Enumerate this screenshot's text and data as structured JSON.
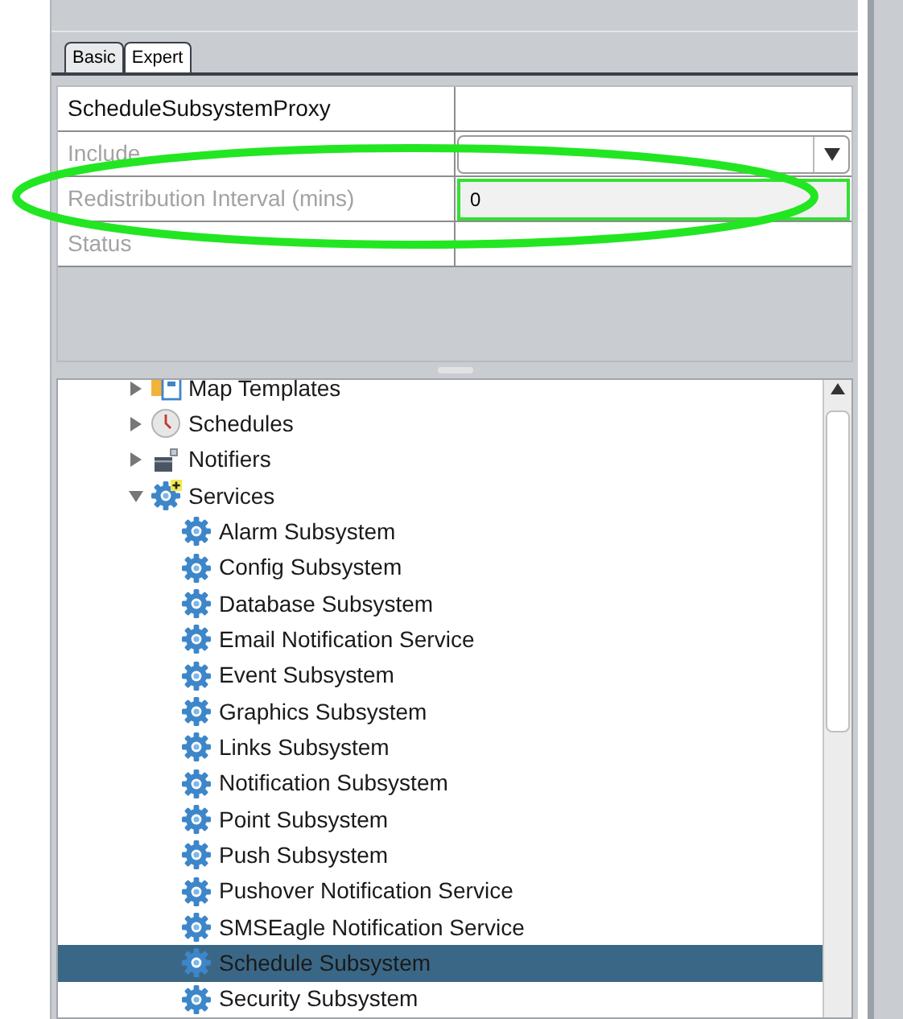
{
  "tabs": [
    {
      "label": "Basic",
      "selected": true
    },
    {
      "label": "Expert",
      "selected": false
    }
  ],
  "properties": [
    {
      "kind": "header",
      "label": "ScheduleSubsystemProxy",
      "disabled": false
    },
    {
      "kind": "dropdown",
      "label": "Include",
      "disabled": true
    },
    {
      "kind": "field",
      "label": "Redistribution Interval (mins)",
      "value": "0",
      "disabled": true
    },
    {
      "kind": "plain",
      "label": "Status",
      "disabled": true
    }
  ],
  "tree": [
    {
      "label": "Map Templates",
      "kind": "map",
      "expanded": false,
      "selected": false
    },
    {
      "label": "Schedules",
      "kind": "clock",
      "expanded": false,
      "selected": false
    },
    {
      "label": "Notifiers",
      "kind": "notifier",
      "expanded": false,
      "selected": false
    },
    {
      "label": "Services",
      "kind": "services",
      "expanded": true,
      "selected": false,
      "children": [
        {
          "label": "Alarm Subsystem",
          "kind": "gear",
          "selected": false
        },
        {
          "label": "Config Subsystem",
          "kind": "gear",
          "selected": false
        },
        {
          "label": "Database Subsystem",
          "kind": "gear",
          "selected": false
        },
        {
          "label": "Email Notification Service",
          "kind": "gear",
          "selected": false
        },
        {
          "label": "Event Subsystem",
          "kind": "gear",
          "selected": false
        },
        {
          "label": "Graphics Subsystem",
          "kind": "gear",
          "selected": false
        },
        {
          "label": "Links Subsystem",
          "kind": "gear",
          "selected": false
        },
        {
          "label": "Notification Subsystem",
          "kind": "gear",
          "selected": false
        },
        {
          "label": "Point Subsystem",
          "kind": "gear",
          "selected": false
        },
        {
          "label": "Push Subsystem",
          "kind": "gear",
          "selected": false
        },
        {
          "label": "Pushover Notification Service",
          "kind": "gear",
          "selected": false
        },
        {
          "label": "SMSEagle Notification Service",
          "kind": "gear",
          "selected": false
        },
        {
          "label": "Schedule Subsystem",
          "kind": "gear",
          "selected": true
        },
        {
          "label": "Security Subsystem",
          "kind": "gear",
          "selected": false
        }
      ]
    }
  ]
}
